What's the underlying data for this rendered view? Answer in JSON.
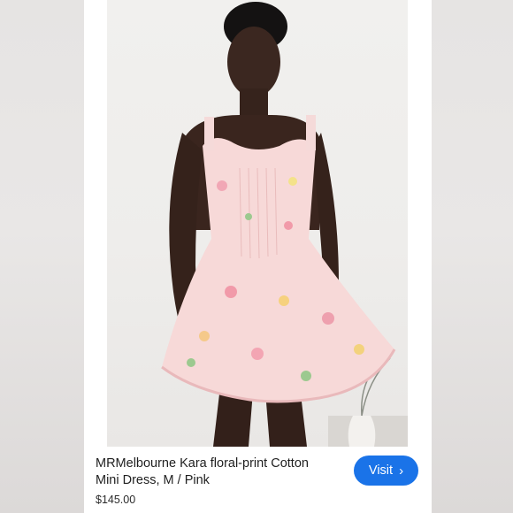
{
  "product": {
    "title": "MRMelbourne Kara floral-print Cotton Mini Dress, M / Pink",
    "price": "$145.00"
  },
  "actions": {
    "visit_label": "Visit",
    "visit_icon": "chevron-right-icon"
  },
  "colors": {
    "button": "#1a73e8",
    "dress": "#f7d9d8"
  }
}
